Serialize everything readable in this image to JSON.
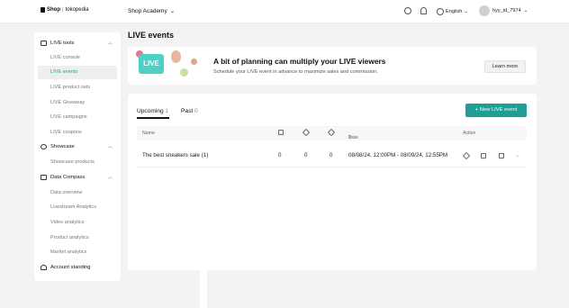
{
  "header": {
    "logo_brand": "Shop",
    "logo_sep": "|",
    "logo_partner": "tokopedia",
    "academy": "Shop Academy",
    "language": "English",
    "username": "hyy_id_7974"
  },
  "sidebar": {
    "groups": [
      {
        "label": "LIVE tools",
        "items": [
          "LIVE console",
          "LIVE events",
          "LIVE product sets",
          "LIVE Giveaway",
          "LIVE campaigns",
          "LIVE coupons"
        ]
      },
      {
        "label": "Showcase",
        "items": [
          "Showcase products"
        ]
      },
      {
        "label": "Data Compass",
        "items": [
          "Data overview",
          "Livestream Analytics",
          "Video analytics",
          "Product analytics",
          "Market analytics"
        ]
      }
    ],
    "account": "Account standing",
    "active": "LIVE events"
  },
  "page": {
    "title": "LIVE events"
  },
  "banner": {
    "badge": "LIVE",
    "title": "A bit of planning can multiply your LIVE viewers",
    "subtitle": "Schedule your LIVE event in advance to maximize sales and commission.",
    "button": "Learn more"
  },
  "tabs": {
    "upcoming_label": "Upcoming",
    "upcoming_count": "1",
    "past_label": "Past",
    "past_count": "0"
  },
  "new_button": "+ New LIVE event",
  "table": {
    "headers": {
      "name": "Name",
      "date": "Date",
      "action": "Action"
    },
    "rows": [
      {
        "name": "The best sneakers sale (1)",
        "c1": "0",
        "c2": "0",
        "c3": "0",
        "date": "08/08/24, 12:00PM - 08/09/24, 12:55PM"
      }
    ]
  },
  "colors": {
    "accent": "#1e9f96",
    "badge": "#4fd0c6"
  }
}
